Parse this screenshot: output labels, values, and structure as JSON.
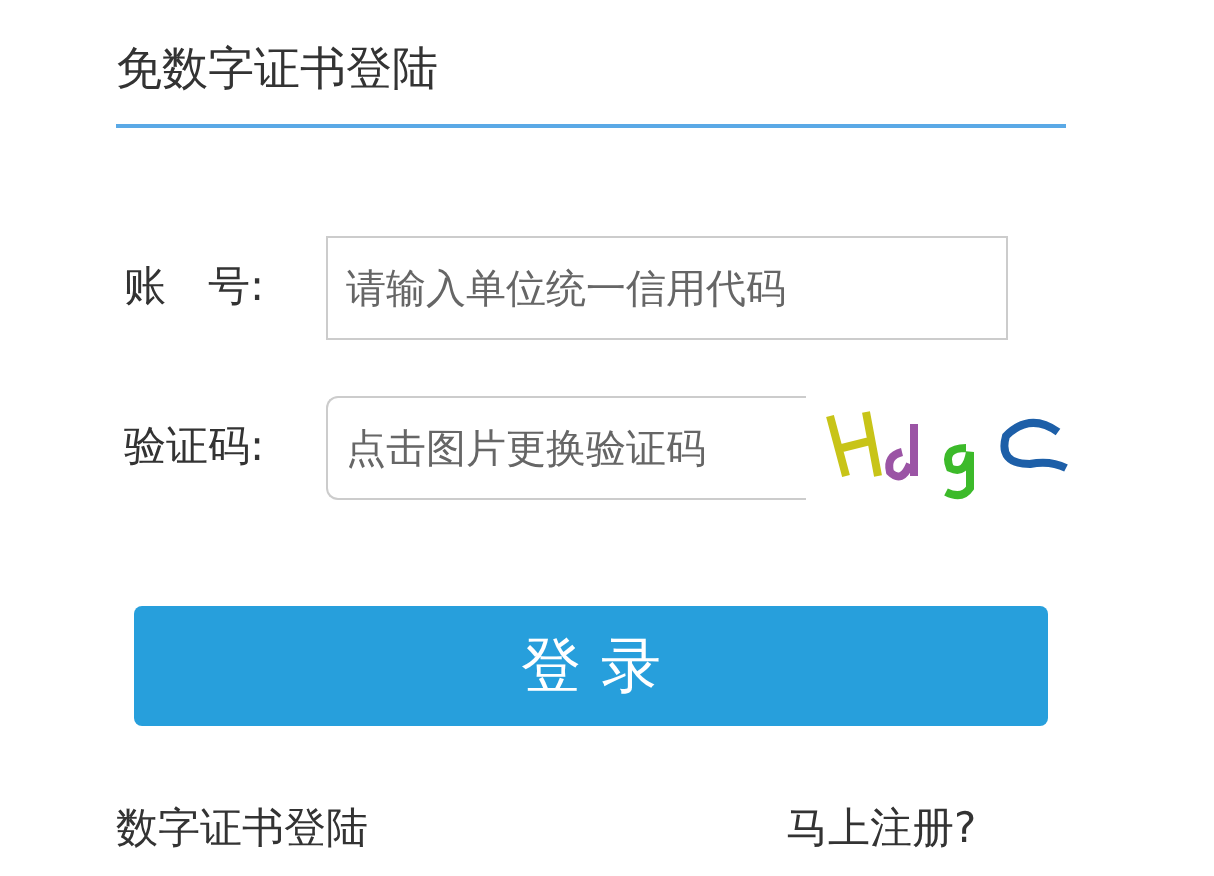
{
  "title": "免数字证书登陆",
  "fields": [
    {
      "label": "账　号:",
      "placeholder": "请输入单位统一信用代码",
      "kind": "text"
    },
    {
      "label": "验证码:",
      "placeholder": "点击图片更换验证码",
      "kind": "captcha"
    }
  ],
  "login_button": "登 录",
  "links": [
    "数字证书登陆",
    "马上注册?"
  ]
}
